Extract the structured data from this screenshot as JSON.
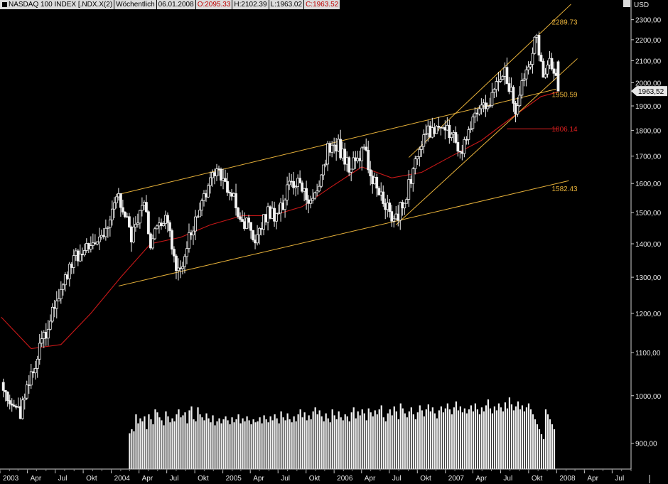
{
  "header": {
    "instrument": "NASDAQ 100 INDEX [.NDX.X(2)",
    "period": "Wöchentlich",
    "date": "06.01.2008",
    "open": "O:2095.33",
    "high": "H:2102.39",
    "low": "L:1963.02",
    "close": "C:1963.52"
  },
  "price_axis": {
    "currency": "USD",
    "last_price_label": "1963,52"
  },
  "annotations": [
    {
      "text": "2289.73",
      "color": "#e8b23a",
      "value": 2289.73
    },
    {
      "text": "1950.59",
      "color": "#e8b23a",
      "value": 1950.59
    },
    {
      "text": "1806.14",
      "color": "#e02020",
      "value": 1806.14
    },
    {
      "text": "1582.43",
      "color": "#e8b23a",
      "value": 1582.43
    }
  ],
  "chart_data": {
    "type": "candlestick",
    "title": "NASDAQ 100 INDEX",
    "y_scale": "log",
    "ylim": [
      850,
      2350
    ],
    "y_ticks": [
      900,
      1000,
      1100,
      1200,
      1300,
      1400,
      1500,
      1600,
      1700,
      1800,
      1900,
      2000,
      2100,
      2200,
      2300
    ],
    "y_tick_labels": [
      "900,00",
      "1000,00",
      "1100,00",
      "1200,00",
      "1300,00",
      "1400,00",
      "1500,00",
      "1600,00",
      "1700,00",
      "1800,00",
      "1900,00",
      "2000,00",
      "2100,00",
      "2200,00",
      "2300,00"
    ],
    "x_labels": [
      "2003",
      "Apr",
      "Jul",
      "Okt",
      "2004",
      "Apr",
      "Jul",
      "Okt",
      "2005",
      "Apr",
      "Jul",
      "Okt",
      "2006",
      "Apr",
      "Jul",
      "Okt",
      "2007",
      "Apr",
      "Jul",
      "Okt",
      "2008",
      "Apr",
      "Jul"
    ],
    "x_start": "2003-01-01",
    "x_end": "2008-09-01",
    "price_path": [
      [
        "2003-01-05",
        1030
      ],
      [
        "2003-03-09",
        960
      ],
      [
        "2003-05-04",
        1090
      ],
      [
        "2003-07-13",
        1250
      ],
      [
        "2003-09-14",
        1370
      ],
      [
        "2003-12-07",
        1420
      ],
      [
        "2004-01-18",
        1560
      ],
      [
        "2004-03-07",
        1430
      ],
      [
        "2004-04-18",
        1520
      ],
      [
        "2004-05-09",
        1405
      ],
      [
        "2004-06-27",
        1480
      ],
      [
        "2004-08-08",
        1310
      ],
      [
        "2004-10-03",
        1480
      ],
      [
        "2004-11-21",
        1620
      ],
      [
        "2004-12-26",
        1630
      ],
      [
        "2005-02-20",
        1510
      ],
      [
        "2005-04-17",
        1410
      ],
      [
        "2005-05-29",
        1510
      ],
      [
        "2005-07-03",
        1490
      ],
      [
        "2005-08-14",
        1620
      ],
      [
        "2005-10-23",
        1530
      ],
      [
        "2005-12-11",
        1720
      ],
      [
        "2006-01-15",
        1740
      ],
      [
        "2006-02-19",
        1650
      ],
      [
        "2006-04-09",
        1720
      ],
      [
        "2006-05-21",
        1580
      ],
      [
        "2006-07-16",
        1470
      ],
      [
        "2006-08-27",
        1560
      ],
      [
        "2006-10-22",
        1780
      ],
      [
        "2006-11-26",
        1810
      ],
      [
        "2007-01-07",
        1790
      ],
      [
        "2007-02-25",
        1730
      ],
      [
        "2007-04-15",
        1880
      ],
      [
        "2007-05-27",
        1930
      ],
      [
        "2007-07-15",
        2050
      ],
      [
        "2007-08-19",
        1890
      ],
      [
        "2007-09-30",
        2080
      ],
      [
        "2007-10-28",
        2210
      ],
      [
        "2007-11-18",
        2040
      ],
      [
        "2007-12-09",
        2120
      ],
      [
        "2008-01-06",
        1963.52
      ]
    ],
    "moving_average_path": [
      [
        "2003-01-05",
        1190
      ],
      [
        "2003-04-13",
        1110
      ],
      [
        "2003-07-20",
        1120
      ],
      [
        "2003-10-26",
        1200
      ],
      [
        "2004-02-01",
        1300
      ],
      [
        "2004-05-09",
        1400
      ],
      [
        "2004-08-15",
        1420
      ],
      [
        "2004-11-21",
        1460
      ],
      [
        "2005-03-06",
        1490
      ],
      [
        "2005-06-12",
        1490
      ],
      [
        "2005-09-18",
        1520
      ],
      [
        "2005-12-25",
        1590
      ],
      [
        "2006-04-02",
        1660
      ],
      [
        "2006-07-09",
        1620
      ],
      [
        "2006-10-15",
        1640
      ],
      [
        "2007-01-21",
        1700
      ],
      [
        "2007-04-29",
        1760
      ],
      [
        "2007-08-05",
        1850
      ],
      [
        "2007-11-11",
        1940
      ],
      [
        "2008-01-06",
        1960
      ]
    ],
    "trend_lines": [
      {
        "start": [
          "2004-01-18",
          1560
        ],
        "end": [
          "2007-12-30",
          1972
        ]
      },
      {
        "start": [
          "2004-01-25",
          1275
        ],
        "end": [
          "2008-02-10",
          1610
        ]
      },
      {
        "start": [
          "2006-07-23",
          1460
        ],
        "end": [
          "2008-03-09",
          2110
        ]
      },
      {
        "start": [
          "2006-09-03",
          1695
        ],
        "end": [
          "2008-02-17",
          2380
        ]
      }
    ],
    "horizontal_lines": [
      {
        "value": 1806.14,
        "from": "2007-07-22",
        "to": "2008-01-06"
      }
    ],
    "volume_scale": [
      0,
      100
    ],
    "volume_start": "2004-03-01",
    "volume_bars": [
      36,
      40,
      38,
      55,
      46,
      51,
      48,
      53,
      40,
      55,
      50,
      45,
      60,
      57,
      52,
      49,
      44,
      58,
      53,
      47,
      51,
      48,
      55,
      60,
      52,
      54,
      57,
      46,
      59,
      63,
      50,
      48,
      62,
      55,
      52,
      49,
      56,
      51,
      47,
      54,
      44,
      48,
      51,
      46,
      50,
      53,
      49,
      45,
      52,
      47,
      50,
      55,
      46,
      51,
      48,
      53,
      49,
      45,
      50,
      47,
      48,
      52,
      46,
      54,
      50,
      47,
      53,
      49,
      55,
      51,
      46,
      58,
      52,
      49,
      56,
      50,
      47,
      53,
      48,
      55,
      60,
      52,
      57,
      49,
      54,
      50,
      58,
      62,
      55,
      59,
      53,
      48,
      56,
      51,
      47,
      60,
      54,
      50,
      58,
      52,
      49,
      55,
      53,
      48,
      57,
      62,
      51,
      58,
      54,
      60,
      56,
      49,
      61,
      57,
      53,
      59,
      55,
      60,
      64,
      52,
      48,
      56,
      60,
      54,
      63,
      58,
      50,
      66,
      61,
      56,
      52,
      58,
      62,
      55,
      50,
      57,
      64,
      59,
      53,
      60,
      65,
      58,
      62,
      56,
      51,
      59,
      63,
      57,
      61,
      66,
      60,
      55,
      62,
      68,
      59,
      63,
      57,
      61,
      56,
      60,
      64,
      58,
      66,
      60,
      55,
      62,
      58,
      64,
      70,
      61,
      56,
      63,
      59,
      66,
      62,
      58,
      67,
      61,
      72,
      65,
      59,
      63,
      68,
      60,
      64,
      58,
      62,
      66,
      60,
      55,
      50,
      45,
      40,
      35,
      30,
      60,
      55,
      50,
      45,
      40
    ]
  }
}
